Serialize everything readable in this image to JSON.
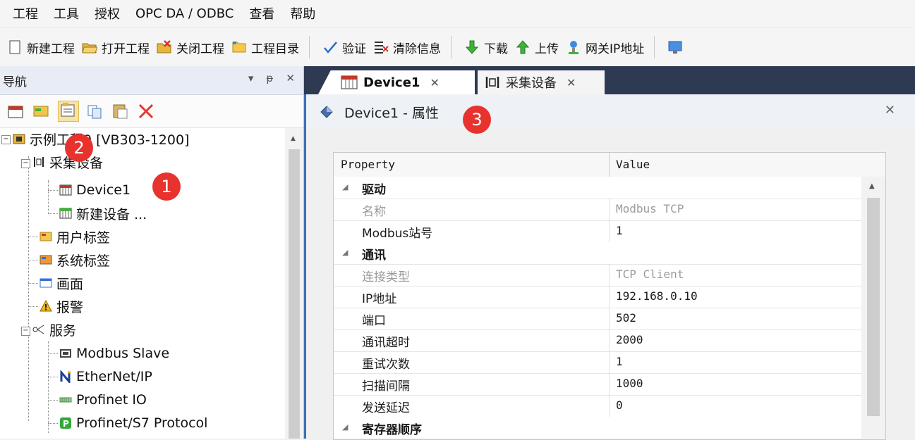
{
  "menu": [
    "工程",
    "工具",
    "授权",
    "OPC DA / ODBC",
    "查看",
    "帮助"
  ],
  "toolbar": {
    "new_project": "新建工程",
    "open_project": "打开工程",
    "close_project": "关闭工程",
    "project_dir": "工程目录",
    "verify": "验证",
    "clear_info": "清除信息",
    "download": "下载",
    "upload": "上传",
    "gateway_ip": "网关IP地址"
  },
  "nav": {
    "title": "导航",
    "ctrl_dropdown": "▾",
    "ctrl_pin": "ᵽ",
    "ctrl_close": "✕"
  },
  "tree": {
    "root": "示例工程9 [VB303-1200]",
    "collect": "采集设备",
    "device1": "Device1",
    "new_device": "新建设备 ...",
    "user_tags": "用户标签",
    "sys_tags": "系统标签",
    "screens": "画面",
    "alarm": "报警",
    "service": "服务",
    "modbus_slave": "Modbus Slave",
    "ethernet_ip": "EtherNet/IP",
    "profinet_io": "Profinet IO",
    "profinet_s7": "Profinet/S7 Protocol"
  },
  "tabs": {
    "device1": "Device1",
    "collect": "采集设备",
    "close": "✕"
  },
  "props_window": {
    "title": "Device1 - 属性",
    "close": "✕"
  },
  "grid": {
    "col_property": "Property",
    "col_value": "Value",
    "cat_driver": "驱动",
    "name_k": "名称",
    "name_v": "Modbus TCP",
    "station_k": "Modbus站号",
    "station_v": "1",
    "cat_comm": "通讯",
    "conn_k": "连接类型",
    "conn_v": "TCP Client",
    "ip_k": "IP地址",
    "ip_v": "192.168.0.10",
    "port_k": "端口",
    "port_v": "502",
    "timeout_k": "通讯超时",
    "timeout_v": "2000",
    "retry_k": "重试次数",
    "retry_v": "1",
    "scan_k": "扫描间隔",
    "scan_v": "1000",
    "delay_k": "发送延迟",
    "delay_v": "0",
    "cat_reg": "寄存器顺序"
  },
  "badges": {
    "b1": "1",
    "b2": "2",
    "b3": "3"
  },
  "colors": {
    "accent": "#3d6fb6",
    "tab_strip": "#2d3a52",
    "badge": "#e8322d"
  }
}
